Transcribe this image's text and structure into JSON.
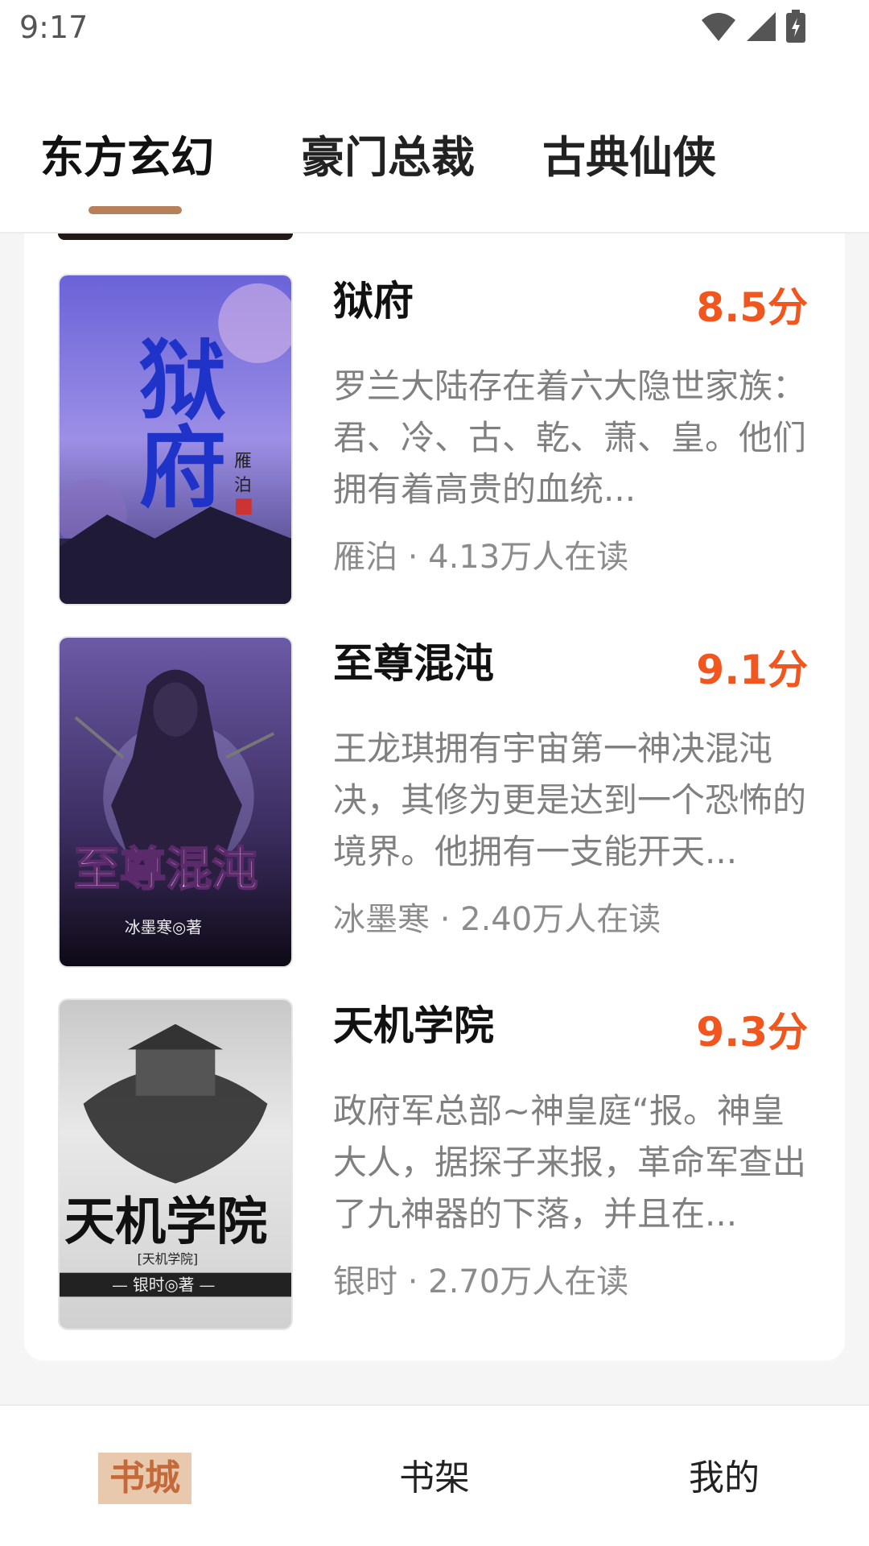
{
  "status_bar": {
    "time": "9:17",
    "icons": [
      "wifi-icon",
      "signal-icon",
      "battery-charging-icon"
    ]
  },
  "tabs": [
    {
      "label": "东方玄幻",
      "active": true
    },
    {
      "label": "豪门总裁",
      "active": false
    },
    {
      "label": "古典仙侠",
      "active": false
    }
  ],
  "books": [
    {
      "title": "狱府",
      "score": "8.5分",
      "description": "罗兰大陆存在着六大隐世家族：君、冷、古、乾、萧、皇。他们拥有着高贵的血统...",
      "meta": "雁泊 · 4.13万人在读",
      "cover_text": "狱府",
      "cover_colors": {
        "top": "#3a3fa8",
        "bottom": "#5b4aa0",
        "accent": "#2a2fd0"
      }
    },
    {
      "title": "至尊混沌",
      "score": "9.1分",
      "description": "王龙琪拥有宇宙第一神决混沌决，其修为更是达到一个恐怖的境界。他拥有一支能开天...",
      "meta": "冰墨寒 · 2.40万人在读",
      "cover_text": "至尊混沌",
      "cover_sub": "冰墨寒◎著",
      "cover_colors": {
        "top": "#5a4a8a",
        "bottom": "#1a1428",
        "accent": "#e8c8f0"
      }
    },
    {
      "title": "天机学院",
      "score": "9.3分",
      "description": "政府军总部~神皇庭“报。神皇大人，据探子来报，革命军查出了九神器的下落，并且在...",
      "meta": "银时 · 2.70万人在读",
      "cover_text": "天机学院",
      "cover_sub": "— 银时◎著 —",
      "cover_tag": "[天机学院]",
      "cover_colors": {
        "top": "#cfcfcf",
        "bottom": "#eeeeee",
        "accent": "#111111"
      }
    }
  ],
  "bottom_nav": [
    {
      "label": "书城",
      "active": true
    },
    {
      "label": "书架",
      "active": false
    },
    {
      "label": "我的",
      "active": false
    }
  ],
  "colors": {
    "accent": "#b8805a",
    "score": "#f1561e",
    "nav_active_bg": "#e8c9ad"
  }
}
